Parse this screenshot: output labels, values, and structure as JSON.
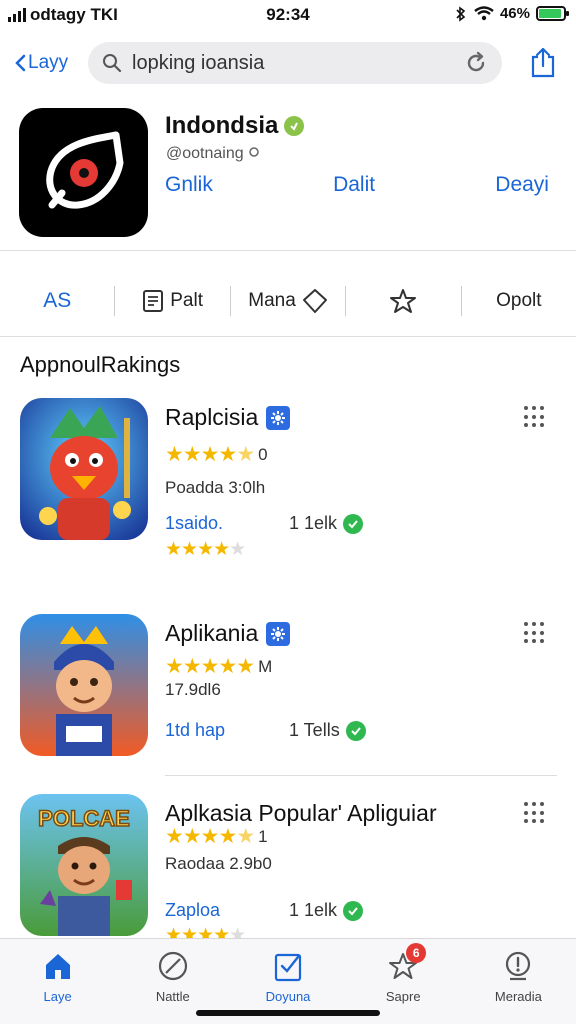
{
  "status": {
    "carrier": "odtagy TKI",
    "time": "92:34",
    "battery": "46%",
    "battery_level": 0.9
  },
  "nav": {
    "back_label": "Layy",
    "search_query": "lopking ioansia"
  },
  "app": {
    "title": "Indondsia",
    "handle": "@ootnaing",
    "links": [
      "Gnlik",
      "Dalit",
      "Deayi"
    ]
  },
  "actions": [
    "AS",
    "Palt",
    "Mana",
    "",
    "Opolt"
  ],
  "section_title": "AppnoulRakings",
  "items": [
    {
      "title": "Raplcisia",
      "rating_text": "0",
      "stars_filled": 4.5,
      "meta": "Poadda 3:0lh",
      "link": "1saido.",
      "count": "1 1elk",
      "stars2_filled": 4.5
    },
    {
      "title": "Aplikania",
      "rating_text": "M",
      "stars_filled": 5,
      "meta": "17.9dl6",
      "link": "1td hap",
      "count": "1 Tells",
      "stars2_filled": 0
    },
    {
      "title": "Aplkasia Popular' Apliguiar",
      "rating_text": "1",
      "stars_filled": 4.5,
      "meta": "Raodaa 2.9b0",
      "link": "Zaploa",
      "count": "1 1elk",
      "stars2_filled": 4.5
    }
  ],
  "tabs": [
    {
      "label": "Laye",
      "icon": "home-icon",
      "active": true
    },
    {
      "label": "Nattle",
      "icon": "compass-icon",
      "active": false
    },
    {
      "label": "Doyuna",
      "icon": "clipboard-check-icon",
      "active": true
    },
    {
      "label": "Sapre",
      "icon": "star-icon",
      "badge": "6",
      "active": false
    },
    {
      "label": "Meradia",
      "icon": "alert-icon",
      "active": false
    }
  ],
  "colors": {
    "accent": "#1a66d6",
    "star": "#f5b800",
    "check": "#2fb84f",
    "badge": "#2d6be0"
  }
}
